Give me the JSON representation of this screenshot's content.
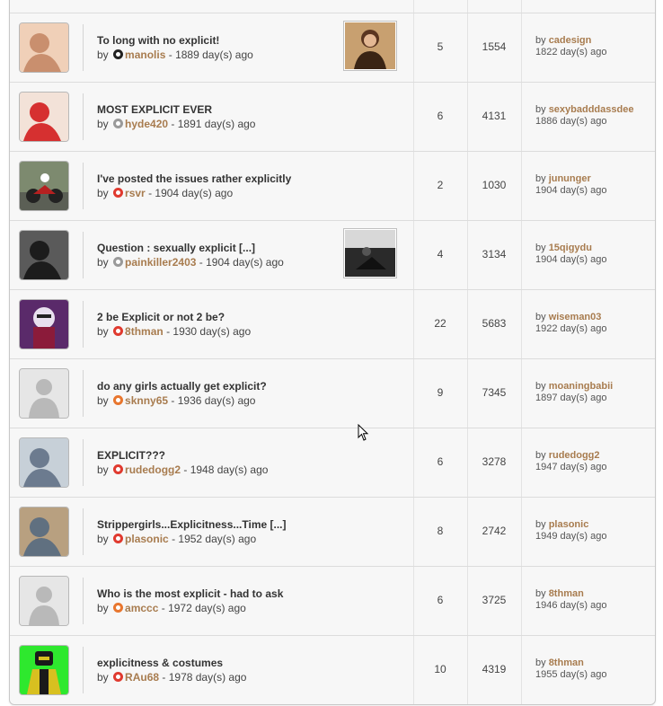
{
  "by_word": "by",
  "rows": [
    {
      "title": "To long with no explicit!",
      "author": "manolis",
      "rank_color": "#222222",
      "age": "- 1889 day(s) ago",
      "replies": "5",
      "views": "1554",
      "last_user": "cadesign",
      "last_age": "1822 day(s) ago",
      "avatar_icon": "photo-avatar",
      "has_thumb": true
    },
    {
      "title": "MOST EXPLICIT EVER",
      "author": "hyde420",
      "rank_color": "#9a9a9a",
      "age": "- 1891 day(s) ago",
      "replies": "6",
      "views": "4131",
      "last_user": "sexybadddassdee",
      "last_age": "1886 day(s) ago",
      "avatar_icon": "photo-avatar",
      "has_thumb": false
    },
    {
      "title": "I've posted the issues rather explicitly",
      "author": "rsvr",
      "rank_color": "#e03a2f",
      "age": "- 1904 day(s) ago",
      "replies": "2",
      "views": "1030",
      "last_user": "jununger",
      "last_age": "1904 day(s) ago",
      "avatar_icon": "motorcycle-avatar",
      "has_thumb": false
    },
    {
      "title": "Question : sexually explicit [...]",
      "author": "painkiller2403",
      "rank_color": "#9a9a9a",
      "age": "- 1904 day(s) ago",
      "replies": "4",
      "views": "3134",
      "last_user": "15qigydu",
      "last_age": "1904 day(s) ago",
      "avatar_icon": "photo-avatar",
      "has_thumb": true
    },
    {
      "title": "2 be Explicit or not 2 be?",
      "author": "8thman",
      "rank_color": "#e03a2f",
      "age": "- 1930 day(s) ago",
      "replies": "22",
      "views": "5683",
      "last_user": "wiseman03",
      "last_age": "1922 day(s) ago",
      "avatar_icon": "comic-avatar",
      "has_thumb": false
    },
    {
      "title": "do any girls actually get explicit?",
      "author": "sknny65",
      "rank_color": "#e8762e",
      "age": "- 1936 day(s) ago",
      "replies": "9",
      "views": "7345",
      "last_user": "moaningbabii",
      "last_age": "1897 day(s) ago",
      "avatar_icon": "default-avatar",
      "has_thumb": false
    },
    {
      "title": "EXPLICIT???",
      "author": "rudedogg2",
      "rank_color": "#e03a2f",
      "age": "- 1948 day(s) ago",
      "replies": "6",
      "views": "3278",
      "last_user": "rudedogg2",
      "last_age": "1947 day(s) ago",
      "avatar_icon": "photo-avatar",
      "has_thumb": false
    },
    {
      "title": "Strippergirls...Explicitness...Time [...]",
      "author": "plasonic",
      "rank_color": "#e03a2f",
      "age": "- 1952 day(s) ago",
      "replies": "8",
      "views": "2742",
      "last_user": "plasonic",
      "last_age": "1949 day(s) ago",
      "avatar_icon": "photo-avatar",
      "has_thumb": false
    },
    {
      "title": "Who is the most explicit - had to ask",
      "author": "amccc",
      "rank_color": "#e8762e",
      "age": "- 1972 day(s) ago",
      "replies": "6",
      "views": "3725",
      "last_user": "8thman",
      "last_age": "1946 day(s) ago",
      "avatar_icon": "default-avatar",
      "has_thumb": false
    },
    {
      "title": "explicitness & costumes",
      "author": "RAu68",
      "rank_color": "#e03a2f",
      "age": "- 1978 day(s) ago",
      "replies": "10",
      "views": "4319",
      "last_user": "8thman",
      "last_age": "1955 day(s) ago",
      "avatar_icon": "costume-avatar",
      "has_thumb": false
    }
  ]
}
